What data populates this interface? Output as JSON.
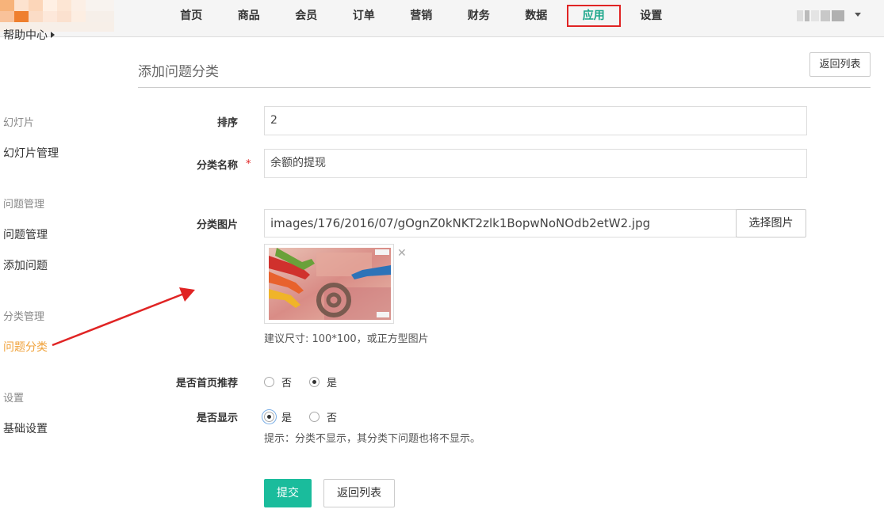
{
  "nav": {
    "items": [
      "首页",
      "商品",
      "会员",
      "订单",
      "营销",
      "财务",
      "数据",
      "应用",
      "设置"
    ],
    "active_index": 7
  },
  "sidebar": {
    "help": "帮助中心",
    "groups": [
      {
        "title": "幻灯片",
        "links": [
          "幻灯片管理"
        ]
      },
      {
        "title": "问题管理",
        "links": [
          "问题管理",
          "添加问题"
        ]
      },
      {
        "title": "分类管理",
        "links": [
          "问题分类"
        ]
      },
      {
        "title": "设置",
        "links": [
          "基础设置"
        ]
      }
    ],
    "active_link": "问题分类"
  },
  "main": {
    "title": "添加问题分类",
    "back_label": "返回列表"
  },
  "form": {
    "sort_label": "排序",
    "sort_value": "2",
    "name_label": "分类名称",
    "required_mark": "*",
    "name_value": "余额的提现",
    "image_label": "分类图片",
    "image_value": "images/176/2016/07/gOgnZ0kNKT2zlk1BopwNoNOdb2etW2.jpg",
    "pick_image_label": "选择图片",
    "remove_mark": "✕",
    "image_hint": "建议尺寸: 100*100，或正方型图片",
    "recommend_label": "是否首页推荐",
    "recommend_options": [
      "否",
      "是"
    ],
    "recommend_selected": "是",
    "show_label": "是否显示",
    "show_options": [
      "是",
      "否"
    ],
    "show_selected": "是",
    "show_hint": "提示：分类不显示，其分类下问题也将不显示。",
    "submit_label": "提交",
    "back_label": "返回列表"
  },
  "colors": {
    "accent": "#1abc9c",
    "active_nav": "#1aa68a",
    "active_sidebar": "#f0a23a",
    "highlight": "#e02424"
  }
}
